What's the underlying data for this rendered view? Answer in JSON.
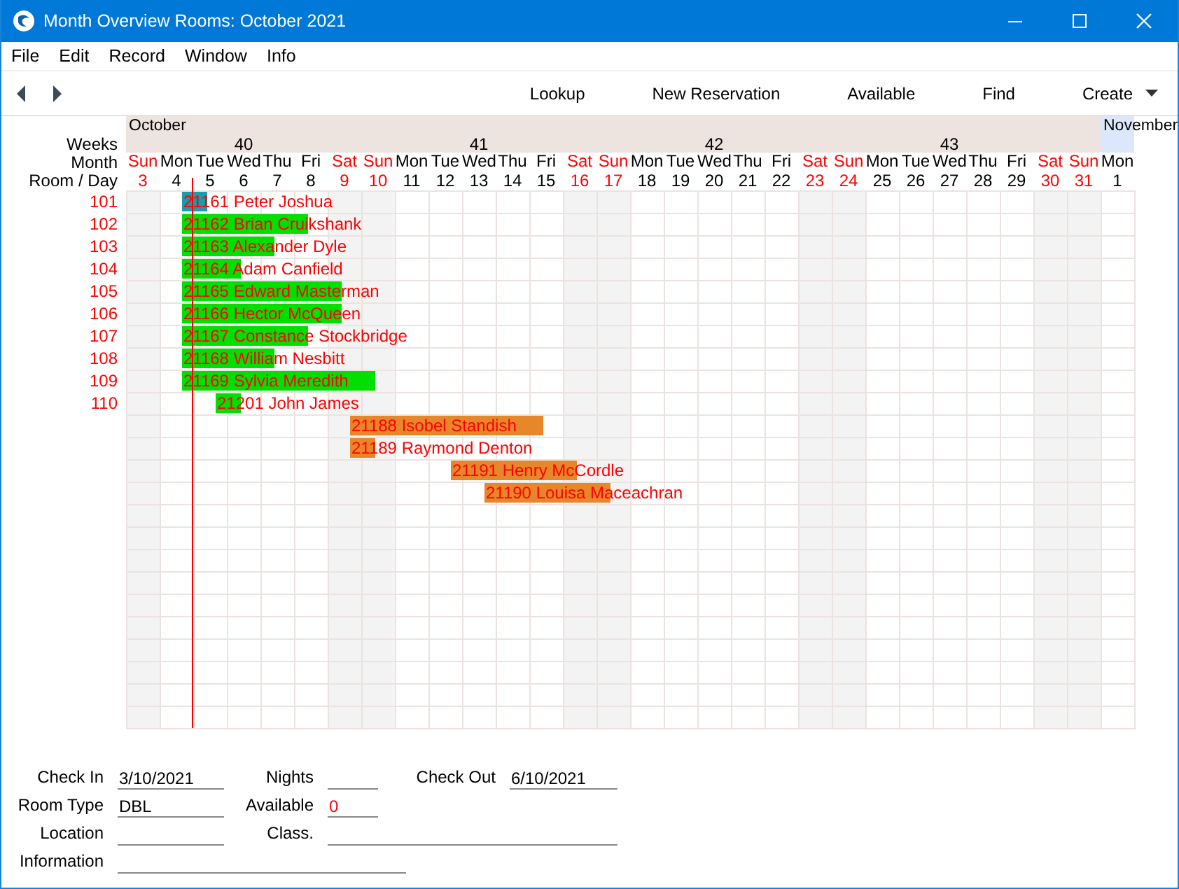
{
  "window": {
    "title": "Month Overview Rooms: October 2021"
  },
  "menu": [
    "File",
    "Edit",
    "Record",
    "Window",
    "Info"
  ],
  "toolbar": {
    "actions": [
      {
        "label": "Lookup",
        "kind": "plain"
      },
      {
        "label": "New Reservation",
        "kind": "plain"
      },
      {
        "label": "Available",
        "kind": "plain"
      },
      {
        "label": "Find",
        "kind": "plain"
      },
      {
        "label": "Create",
        "kind": "dropdown"
      }
    ]
  },
  "calendar": {
    "header_labels": [
      "Weeks",
      "Month",
      "Room / Day"
    ],
    "months": [
      {
        "name": "October",
        "color": "#ede4e0",
        "days": [
          {
            "name": "Sun",
            "number": "3",
            "weekend": true,
            "today": false
          },
          {
            "name": "Mon",
            "number": "4",
            "weekend": false,
            "today": true
          },
          {
            "name": "Tue",
            "number": "5",
            "weekend": false,
            "today": false
          },
          {
            "name": "Wed",
            "number": "6",
            "weekend": false,
            "today": false
          },
          {
            "name": "Thu",
            "number": "7",
            "weekend": false,
            "today": false
          },
          {
            "name": "Fri",
            "number": "8",
            "weekend": false,
            "today": false
          },
          {
            "name": "Sat",
            "number": "9",
            "weekend": true,
            "today": false
          },
          {
            "name": "Sun",
            "number": "10",
            "weekend": true,
            "today": false
          },
          {
            "name": "Mon",
            "number": "11",
            "weekend": false,
            "today": false
          },
          {
            "name": "Tue",
            "number": "12",
            "weekend": false,
            "today": false
          },
          {
            "name": "Wed",
            "number": "13",
            "weekend": false,
            "today": false
          },
          {
            "name": "Thu",
            "number": "14",
            "weekend": false,
            "today": false
          },
          {
            "name": "Fri",
            "number": "15",
            "weekend": false,
            "today": false
          },
          {
            "name": "Sat",
            "number": "16",
            "weekend": true,
            "today": false
          },
          {
            "name": "Sun",
            "number": "17",
            "weekend": true,
            "today": false
          },
          {
            "name": "Mon",
            "number": "18",
            "weekend": false,
            "today": false
          },
          {
            "name": "Tue",
            "number": "19",
            "weekend": false,
            "today": false
          },
          {
            "name": "Wed",
            "number": "20",
            "weekend": false,
            "today": false
          },
          {
            "name": "Thu",
            "number": "21",
            "weekend": false,
            "today": false
          },
          {
            "name": "Fri",
            "number": "22",
            "weekend": false,
            "today": false
          },
          {
            "name": "Sat",
            "number": "23",
            "weekend": true,
            "today": false
          },
          {
            "name": "Sun",
            "number": "24",
            "weekend": true,
            "today": false
          },
          {
            "name": "Mon",
            "number": "25",
            "weekend": false,
            "today": false
          },
          {
            "name": "Tue",
            "number": "26",
            "weekend": false,
            "today": false
          },
          {
            "name": "Wed",
            "number": "27",
            "weekend": false,
            "today": false
          },
          {
            "name": "Thu",
            "number": "28",
            "weekend": false,
            "today": false
          },
          {
            "name": "Fri",
            "number": "29",
            "weekend": false,
            "today": false
          },
          {
            "name": "Sat",
            "number": "30",
            "weekend": true,
            "today": false
          },
          {
            "name": "Sun",
            "number": "31",
            "weekend": true,
            "today": false
          }
        ]
      },
      {
        "name": "November",
        "color": "#dde7fb",
        "days": [
          {
            "name": "Mon",
            "number": "1",
            "weekend": false,
            "today": false
          }
        ]
      }
    ],
    "weeks": [
      "40",
      "41",
      "42",
      "43"
    ],
    "rows": [
      {
        "room": "101",
        "reservations": [
          {
            "label": "21161 Peter Joshua",
            "color": "#1b9aaa"
          }
        ]
      },
      {
        "room": "102",
        "reservations": [
          {
            "label": "21162 Brian Cruikshank",
            "color": "#00e000"
          }
        ]
      },
      {
        "room": "103",
        "reservations": [
          {
            "label": "21163 Alexander Dyle",
            "color": "#00e000"
          }
        ]
      },
      {
        "room": "104",
        "reservations": [
          {
            "label": "21164 Adam Canfield",
            "color": "#00e000"
          }
        ]
      },
      {
        "room": "105",
        "reservations": [
          {
            "label": "21165 Edward Masterman",
            "color": "#00e000"
          }
        ]
      },
      {
        "room": "106",
        "reservations": [
          {
            "label": "21166 Hector McQueen",
            "color": "#00e000"
          }
        ]
      },
      {
        "room": "107",
        "reservations": [
          {
            "label": "21167 Constance Stockbridge",
            "color": "#00e000"
          }
        ]
      },
      {
        "room": "108",
        "reservations": [
          {
            "label": "21168 William Nesbitt",
            "color": "#00e000"
          }
        ]
      },
      {
        "room": "109",
        "reservations": [
          {
            "label": "21169 Sylvia Meredith",
            "color": "#00e000"
          }
        ]
      },
      {
        "room": "110",
        "reservations": [
          {
            "label": "21201 John James",
            "color": "#00e000"
          }
        ]
      },
      {
        "reservations": [
          {
            "label": "21188 Isobel Standish",
            "color": "#e8862a"
          }
        ]
      },
      {
        "reservations": [
          {
            "label": "21189 Raymond Denton",
            "color": "#e8862a"
          }
        ]
      },
      {
        "reservations": [
          {
            "label": "21191 Henry McCordle",
            "color": "#e8862a"
          }
        ]
      },
      {
        "reservations": [
          {
            "label": "21190 Louisa Maceachran",
            "color": "#e8862a"
          }
        ]
      }
    ]
  },
  "form": {
    "rows": [
      [
        {
          "label": "Check In",
          "value": "3/10/2021",
          "alert": false
        },
        {
          "label": "Nights"
        },
        {
          "label": "Check Out",
          "value": "6/10/2021",
          "alert": false
        }
      ],
      [
        {
          "label": "Room Type",
          "value": "DBL",
          "alert": false
        },
        {
          "label": "Available",
          "value": "0",
          "alert": true
        }
      ],
      [
        {
          "label": "Location"
        },
        {
          "label": "Class."
        }
      ],
      [
        {
          "label": "Information"
        }
      ]
    ]
  }
}
